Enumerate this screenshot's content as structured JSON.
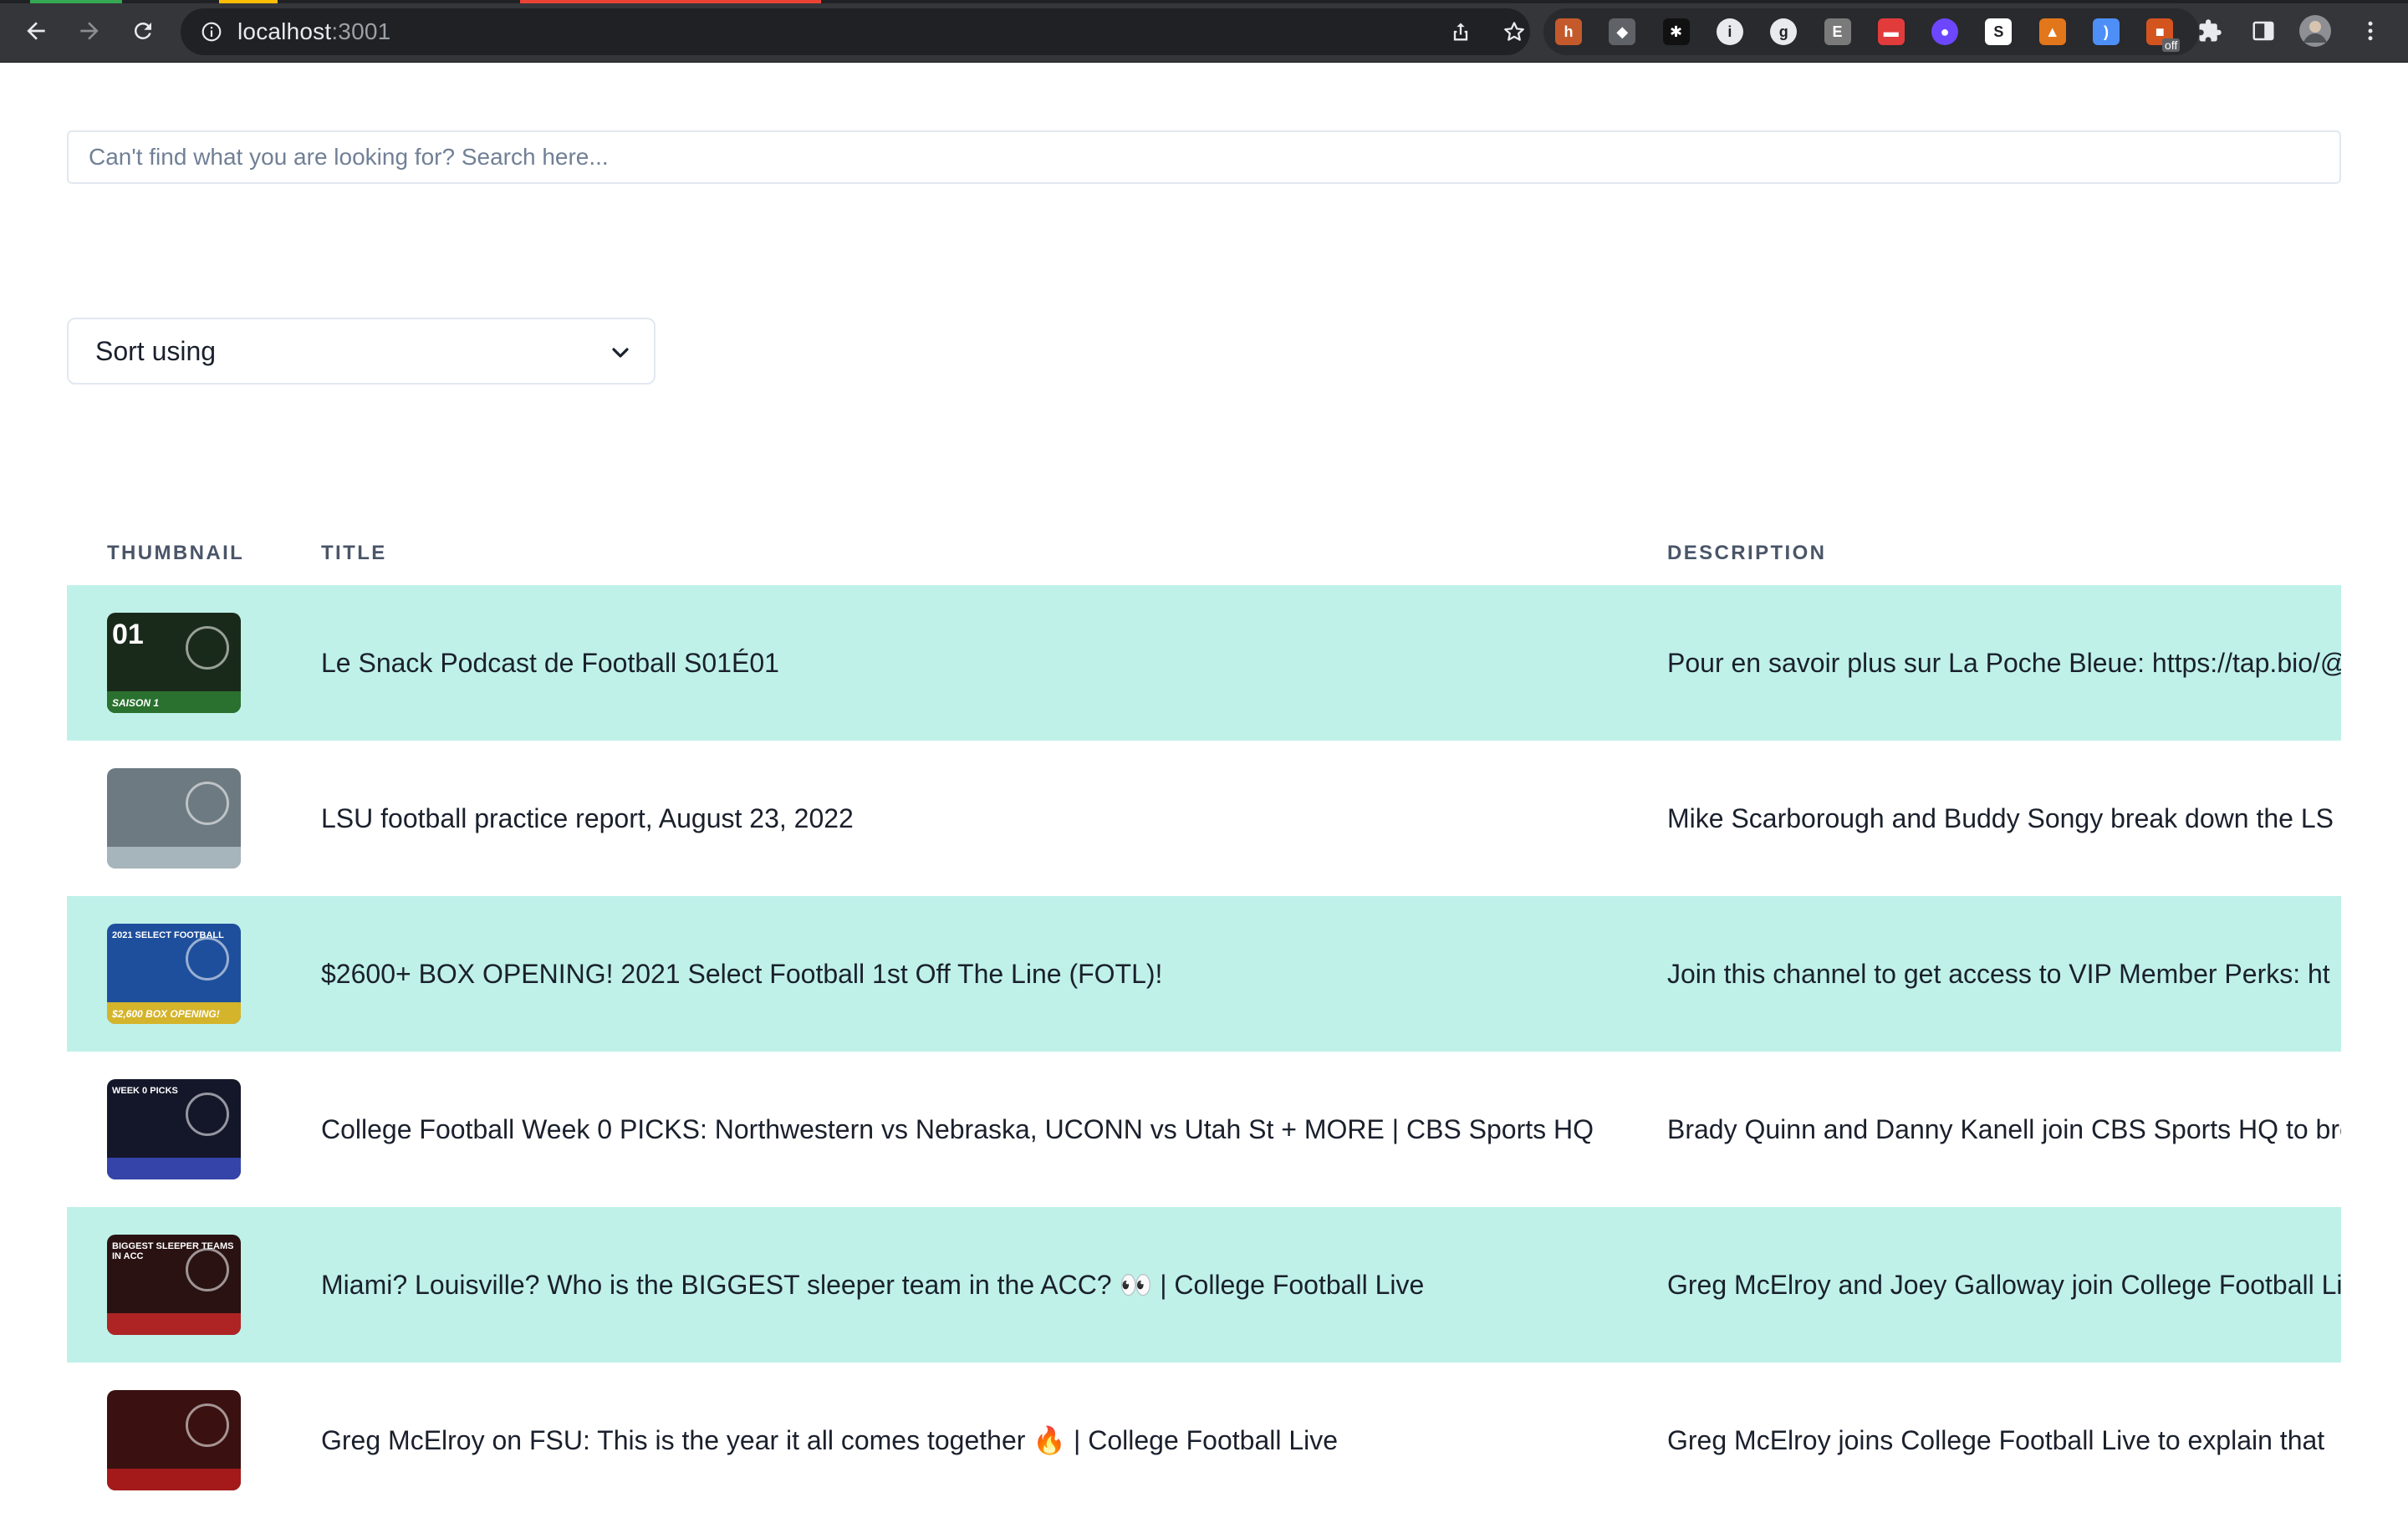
{
  "browser": {
    "url_host": "localhost",
    "url_port": ":3001",
    "extensions": [
      {
        "name": "honey-extension",
        "color": "#c45a2b",
        "glyph": "h"
      },
      {
        "name": "shield-extension",
        "color": "#5f6368",
        "glyph": "◆"
      },
      {
        "name": "spark-extension",
        "color": "#111111",
        "glyph": "✱"
      },
      {
        "name": "info-extension",
        "color": "#e8eaed",
        "glyph": "i"
      },
      {
        "name": "grammar-extension",
        "color": "#e8eaed",
        "glyph": "g"
      },
      {
        "name": "e-extension",
        "color": "#7a7a7a",
        "glyph": "E"
      },
      {
        "name": "red-extension",
        "color": "#e23b3b",
        "glyph": "▬"
      },
      {
        "name": "bot-extension",
        "color": "#6c47ff",
        "glyph": "●"
      },
      {
        "name": "s-extension",
        "color": "#ffffff",
        "glyph": "S"
      },
      {
        "name": "fox-extension",
        "color": "#e2761b",
        "glyph": "▲"
      },
      {
        "name": "wave-extension",
        "color": "#4d8ff7",
        "glyph": ")"
      },
      {
        "name": "off-extension",
        "color": "#d4541f",
        "glyph": "■",
        "badge": "off"
      }
    ]
  },
  "search": {
    "placeholder": "Can't find what you are looking for? Search here..."
  },
  "sort": {
    "label": "Sort using"
  },
  "table": {
    "headers": {
      "thumbnail": "THUMBNAIL",
      "title": "TITLE",
      "description": "DESCRIPTION"
    },
    "rows": [
      {
        "title": "Le Snack Podcast de Football S01É01",
        "description": "Pour en savoir plus sur La Poche Bleue: https://tap.bio/@",
        "thumb_caption": "01",
        "thumb_sub": "SAISON 1",
        "thumb_bg": "#1a2a1a",
        "thumb_accent": "#2e7d32"
      },
      {
        "title": "LSU football practice report, August 23, 2022",
        "description": "Mike Scarborough and Buddy Songy break down the LS",
        "thumb_caption": "",
        "thumb_sub": "",
        "thumb_bg": "#6d7a82",
        "thumb_accent": "#b0bec5"
      },
      {
        "title": "$2600+ BOX OPENING! 2021 Select Football 1st Off The Line (FOTL)!",
        "description": "Join this channel to get access to VIP Member Perks: ht",
        "thumb_caption": "2021 SELECT FOOTBALL",
        "thumb_sub": "$2,600 BOX OPENING!",
        "thumb_bg": "#1e4f9c",
        "thumb_accent": "#f5c518"
      },
      {
        "title": "College Football Week 0 PICKS: Northwestern vs Nebraska, UCONN vs Utah St + MORE | CBS Sports HQ",
        "description": "Brady Quinn and Danny Kanell join CBS Sports HQ to bre",
        "thumb_caption": "WEEK 0 PICKS",
        "thumb_sub": "",
        "thumb_bg": "#14172a",
        "thumb_accent": "#3b4cc0"
      },
      {
        "title": "Miami? Louisville? Who is the BIGGEST sleeper team in the ACC? 👀 | College Football Live",
        "description": "Greg McElroy and Joey Galloway join College Football Li",
        "thumb_caption": "BIGGEST SLEEPER TEAMS IN ACC",
        "thumb_sub": "",
        "thumb_bg": "#2a1212",
        "thumb_accent": "#c62828"
      },
      {
        "title": "Greg McElroy on FSU: This is the year it all comes together 🔥 | College Football Live",
        "description": "Greg McElroy joins College Football Live to explain that",
        "thumb_caption": "",
        "thumb_sub": "",
        "thumb_bg": "#3a1010",
        "thumb_accent": "#b71c1c"
      }
    ]
  },
  "colors": {
    "row_stripe": "#bff1e9",
    "border": "#e2e8f0",
    "header_text": "#4a5568",
    "body_text": "#1a202c"
  }
}
